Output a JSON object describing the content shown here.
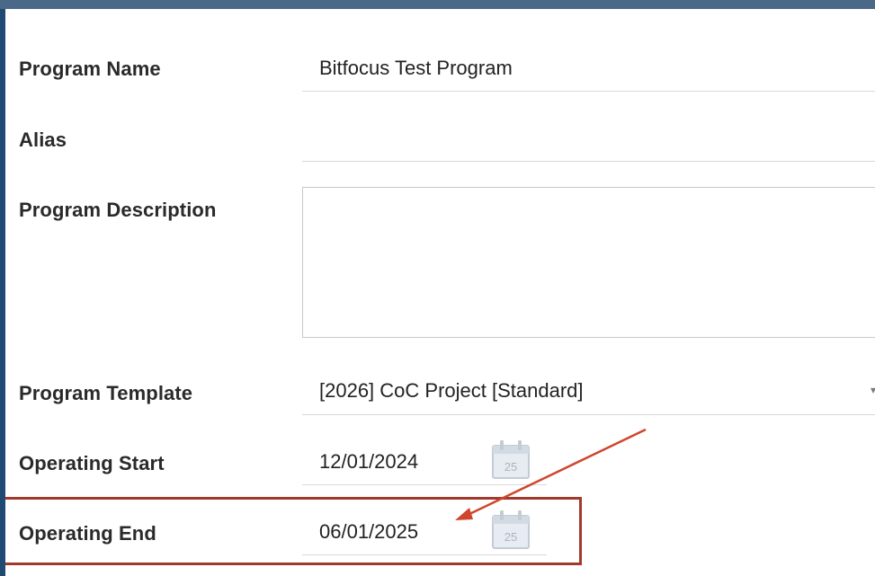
{
  "form": {
    "program_name": {
      "label": "Program Name",
      "value": "Bitfocus Test Program"
    },
    "alias": {
      "label": "Alias",
      "value": ""
    },
    "program_description": {
      "label": "Program Description",
      "value": ""
    },
    "program_template": {
      "label": "Program Template",
      "value": "[2026] CoC Project [Standard]"
    },
    "operating_start": {
      "label": "Operating Start",
      "value": "12/01/2024",
      "calendar_day": "25"
    },
    "operating_end": {
      "label": "Operating End",
      "value": "06/01/2025",
      "calendar_day": "25"
    }
  },
  "colors": {
    "background": "#1e4a73",
    "highlight": "#a3392b",
    "arrow": "#d0452d"
  },
  "icons": {
    "calendar": "calendar-icon",
    "dropdown": "chevron-down-icon"
  }
}
